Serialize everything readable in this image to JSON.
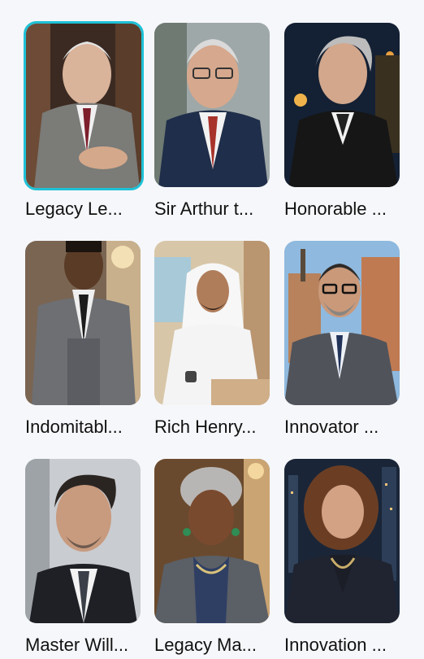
{
  "gallery": {
    "selected_index": 0,
    "items": [
      {
        "label": "Legacy Le..."
      },
      {
        "label": "Sir Arthur t..."
      },
      {
        "label": "Honorable ..."
      },
      {
        "label": "Indomitabl..."
      },
      {
        "label": "Rich Henry..."
      },
      {
        "label": "Innovator ..."
      },
      {
        "label": "Master Will..."
      },
      {
        "label": "Legacy Ma..."
      },
      {
        "label": "Innovation ..."
      }
    ]
  },
  "colors": {
    "selection_border": "#1ec1d6",
    "background": "#f6f7fa"
  }
}
